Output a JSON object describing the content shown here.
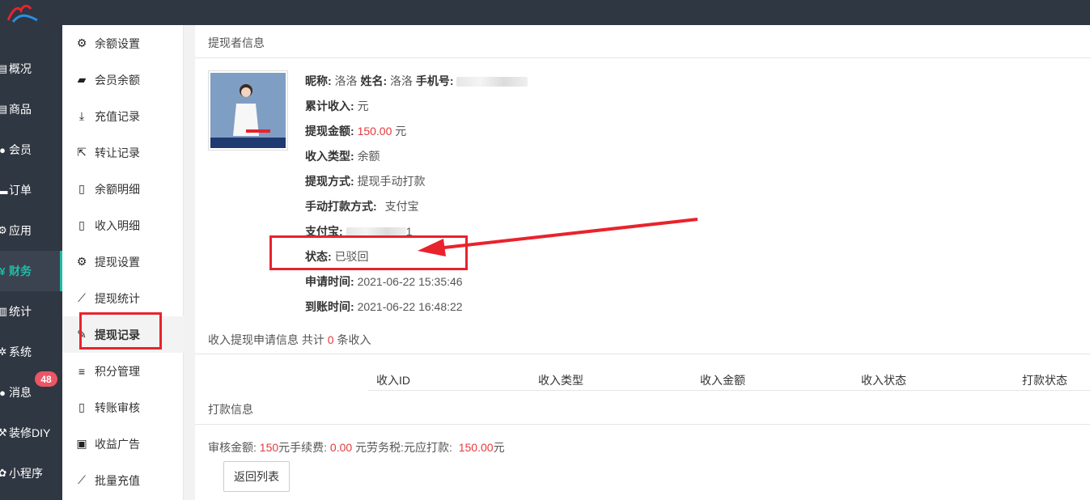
{
  "nav": [
    {
      "label": "概况",
      "icon": "dashboard-icon"
    },
    {
      "label": "商品",
      "icon": "goods-icon"
    },
    {
      "label": "会员",
      "icon": "members-icon"
    },
    {
      "label": "订单",
      "icon": "orders-icon"
    },
    {
      "label": "应用",
      "icon": "apps-icon"
    },
    {
      "label": "财务",
      "icon": "finance-icon",
      "active": true
    },
    {
      "label": "统计",
      "icon": "stats-icon"
    },
    {
      "label": "系统",
      "icon": "system-icon"
    },
    {
      "label": "消息",
      "icon": "message-icon"
    },
    {
      "label": "装修DIY",
      "icon": "diy-icon"
    },
    {
      "label": "小程序",
      "icon": "miniprogram-icon"
    }
  ],
  "message_badge": "48",
  "subnav": [
    {
      "label": "余额设置",
      "icon": "gear-icon"
    },
    {
      "label": "会员余额",
      "icon": "book-icon"
    },
    {
      "label": "充值记录",
      "icon": "download-icon"
    },
    {
      "label": "转让记录",
      "icon": "external-link-icon"
    },
    {
      "label": "余额明细",
      "icon": "document-icon"
    },
    {
      "label": "收入明细",
      "icon": "document-icon"
    },
    {
      "label": "提现设置",
      "icon": "gear-icon"
    },
    {
      "label": "提现统计",
      "icon": "line-chart-icon"
    },
    {
      "label": "提现记录",
      "icon": "pencil-icon",
      "active": true
    },
    {
      "label": "积分管理",
      "icon": "database-icon"
    },
    {
      "label": "转账审核",
      "icon": "document-icon"
    },
    {
      "label": "收益广告",
      "icon": "image-icon"
    },
    {
      "label": "批量充值",
      "icon": "line-chart-icon"
    }
  ],
  "withdrawer": {
    "section_title": "提现者信息",
    "nickname_label": "昵称:",
    "nickname": "洛洛",
    "name_label": "姓名:",
    "name": "洛洛",
    "phone_label": "手机号:",
    "total_income_label": "累计收入:",
    "total_income_unit": "元",
    "amount_label": "提现金额:",
    "amount": "150.00",
    "amount_unit": "元",
    "income_type_label": "收入类型:",
    "income_type": "余额",
    "method_label": "提现方式:",
    "method": "提现手动打款",
    "manual_method_label": "手动打款方式:",
    "manual_method": "支付宝",
    "alipay_label": "支付宝:",
    "alipay_tail": "1",
    "status_label": "状态:",
    "status": "已驳回",
    "apply_time_label": "申请时间:",
    "apply_time": "2021-06-22 15:35:46",
    "arrive_time_label": "到账时间:",
    "arrive_time": "2021-06-22 16:48:22"
  },
  "income_section": {
    "title_prefix": "收入提现申请信息 共计",
    "count": "0",
    "title_suffix": "条收入",
    "columns": [
      "收入ID",
      "收入类型",
      "收入金额",
      "收入状态",
      "打款状态"
    ]
  },
  "payment": {
    "section_title": "打款信息",
    "audit_label": "审核金额:",
    "audit_amount": "150",
    "fee_label": "元手续费:",
    "fee": "0.00",
    "tax_label": "元劳务税:",
    "tax_suffix": "元应打款:",
    "payable": "150.00",
    "payable_unit": "元"
  },
  "back_button": "返回列表",
  "colors": {
    "accent": "#1fbba6",
    "sidebar": "#2f3742",
    "money": "#e4393c",
    "annotation": "#e8232c"
  }
}
